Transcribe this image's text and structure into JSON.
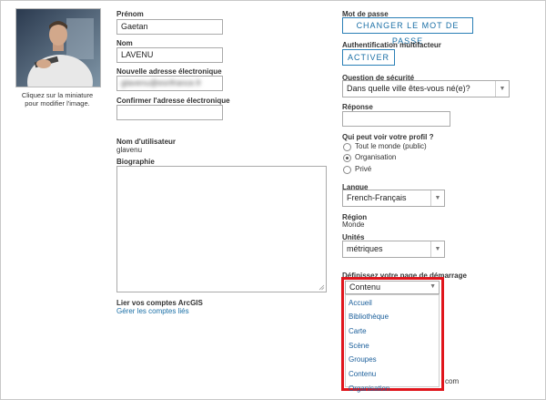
{
  "avatar": {
    "caption_line1": "Cliquez sur la miniature",
    "caption_line2": "pour modifier l'image."
  },
  "firstname": {
    "label": "Prénom",
    "value": "Gaetan"
  },
  "lastname": {
    "label": "Nom",
    "value": "LAVENU"
  },
  "email": {
    "label": "Nouvelle adresse électronique",
    "value": "glavenu@esrifrance.fr"
  },
  "confirm_email": {
    "label": "Confirmer l'adresse électronique",
    "value": ""
  },
  "username": {
    "label": "Nom d'utilisateur",
    "value": "glavenu"
  },
  "bio": {
    "label": "Biographie",
    "value": ""
  },
  "arcgis": {
    "label": "Lier vos comptes ArcGIS",
    "link": "Gérer les comptes liés"
  },
  "password": {
    "label": "Mot de passe",
    "button": "CHANGER LE MOT DE PASSE"
  },
  "mfa": {
    "label": "Authentification multifacteur",
    "button": "ACTIVER"
  },
  "security_question": {
    "label": "Question de sécurité",
    "value": "Dans quelle ville êtes-vous né(e)?"
  },
  "answer": {
    "label": "Réponse",
    "value": ""
  },
  "visibility": {
    "label": "Qui peut voir votre profil ?",
    "options": [
      "Tout le monde (public)",
      "Organisation",
      "Privé"
    ],
    "selected": "Organisation"
  },
  "language": {
    "label": "Langue",
    "value": "French-Français"
  },
  "region": {
    "label": "Région",
    "value": "Monde"
  },
  "units": {
    "label": "Unités",
    "value": "métriques"
  },
  "start_page": {
    "label": "Définissez votre page de démarrage",
    "value": "Contenu",
    "options": [
      "Accueil",
      "Bibliothèque",
      "Carte",
      "Scène",
      "Groupes",
      "Contenu",
      "Organisation"
    ],
    "highlight_color": "#e0151c"
  },
  "partial": {
    "com": "com"
  }
}
